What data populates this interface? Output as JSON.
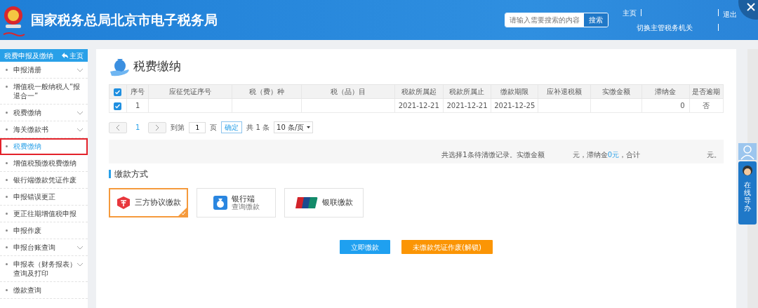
{
  "header": {
    "title": "国家税务总局北京市电子税务局",
    "search": {
      "placeholder": "请输入需要搜索的内容",
      "button": "搜索"
    },
    "home_link": "主页",
    "logout_link": "退出",
    "switch_link": "切换主管税务机关"
  },
  "sidebar": {
    "title": "税费申报及缴纳",
    "home": "主页",
    "items": [
      {
        "label": "申报清册",
        "expandable": true,
        "selected": false
      },
      {
        "label": "增值税一般纳税人“报退合一”",
        "expandable": false,
        "selected": false
      },
      {
        "label": "税费缴纳",
        "expandable": true,
        "selected": false
      },
      {
        "label": "海关缴款书",
        "expandable": true,
        "selected": false
      },
      {
        "label": "税费缴纳",
        "expandable": false,
        "selected": true
      },
      {
        "label": "增值税预缴税费缴纳",
        "expandable": false,
        "selected": false
      },
      {
        "label": "银行端缴款凭证作废",
        "expandable": false,
        "selected": false
      },
      {
        "label": "申报错误更正",
        "expandable": false,
        "selected": false
      },
      {
        "label": "更正往期增值税申报",
        "expandable": false,
        "selected": false
      },
      {
        "label": "申报作废",
        "expandable": false,
        "selected": false
      },
      {
        "label": "申报台账查询",
        "expandable": true,
        "selected": false
      },
      {
        "label": "申报表（财务报表）查询及打印",
        "expandable": true,
        "selected": false
      },
      {
        "label": "缴款查询",
        "expandable": false,
        "selected": false
      }
    ]
  },
  "page": {
    "title": "税费缴纳",
    "table": {
      "all_checked": true,
      "columns": [
        "序号",
        "应征凭证序号",
        "税（费）种",
        "税（品）目",
        "税款所属起",
        "税款所属止",
        "缴款期限",
        "应补退税额",
        "实缴金额",
        "滞纳金",
        "是否逾期"
      ],
      "rows": [
        {
          "checked": true,
          "cells": [
            "1",
            null,
            null,
            null,
            "2021-12-21",
            "2021-12-21",
            "2021-12-25",
            null,
            null,
            "0",
            "否"
          ]
        }
      ]
    },
    "pagination": {
      "page": "1",
      "goto_label": "到第",
      "goto_value": "1",
      "page_unit": "页",
      "confirm": "确定",
      "total": "共 1 条",
      "page_size": "10 条/页"
    },
    "summary": {
      "prefix": "共选择1条待清缴记录。实缴金额",
      "fee_label": "元，滞纳金",
      "fee_value": "0元",
      "total_label": "，合计",
      "suffix": "元。"
    },
    "payment_section": "缴款方式",
    "methods": [
      {
        "kind": "tripartite",
        "label": "三方协议缴款",
        "selected": true
      },
      {
        "kind": "bank",
        "label": "银行端",
        "sub": "查询缴款",
        "selected": false
      },
      {
        "kind": "unionpay",
        "label": "银联缴款",
        "selected": false
      }
    ],
    "buttons": [
      {
        "kind": "primary",
        "label": "立即缴款"
      },
      {
        "kind": "warning",
        "label": "未缴款凭证作废(解锁)"
      }
    ]
  },
  "assistant": {
    "label": "在线导办"
  }
}
